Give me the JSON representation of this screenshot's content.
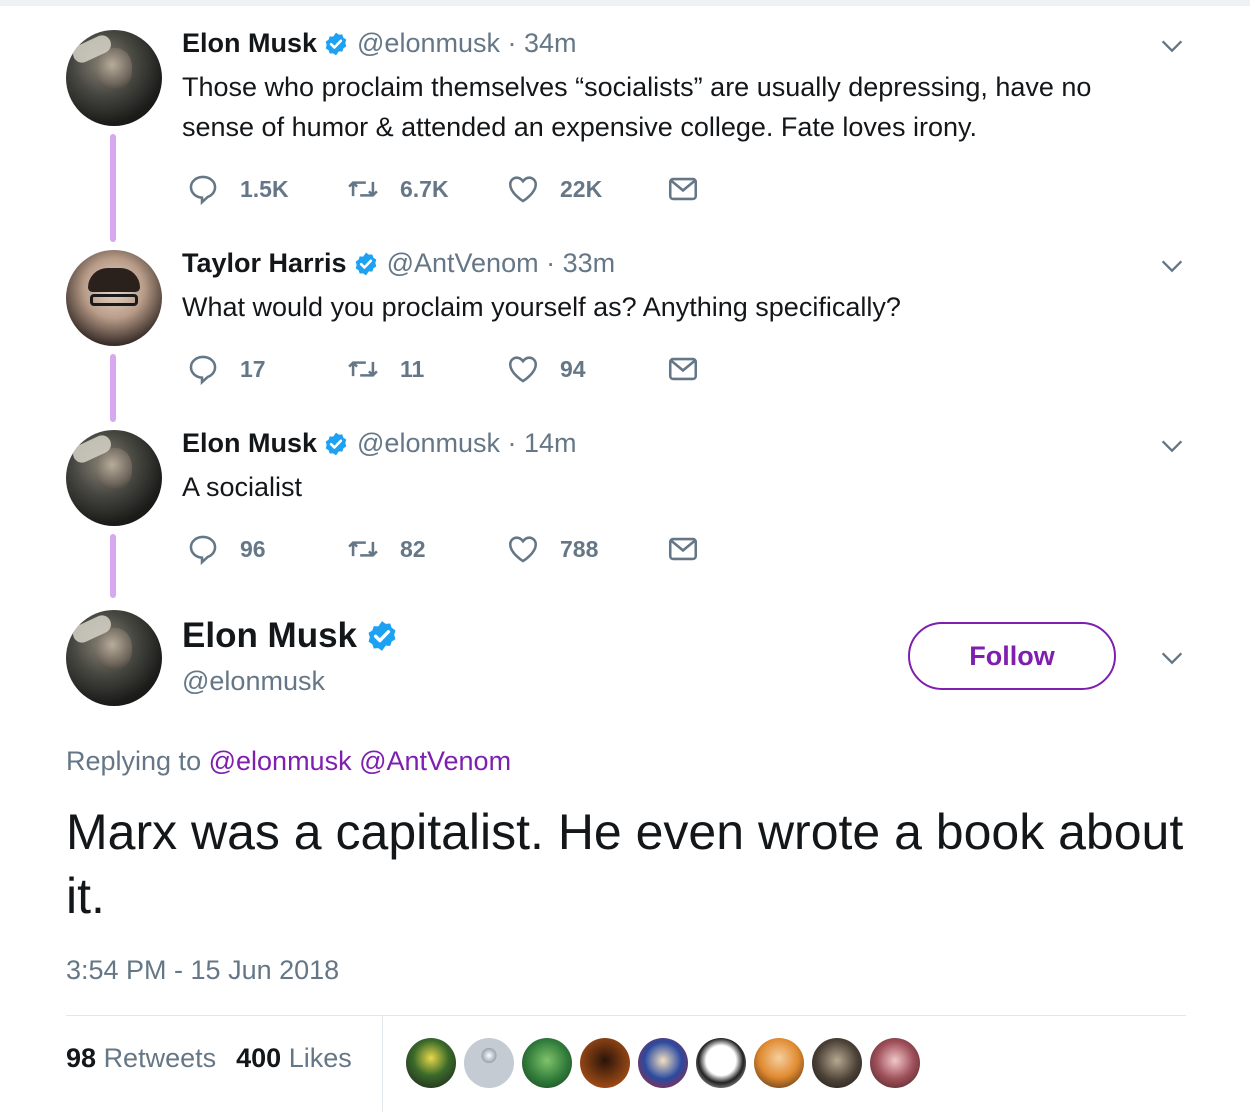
{
  "thread": [
    {
      "name": "Elon Musk",
      "handle": "@elonmusk",
      "time": "· 34m",
      "text": "Those who proclaim themselves “socialists” are usually depressing, have no sense of humor & attended an expensive college. Fate loves irony.",
      "replies": "1.5K",
      "retweets": "6.7K",
      "likes": "22K"
    },
    {
      "name": "Taylor Harris",
      "handle": "@AntVenom",
      "time": "· 33m",
      "text": "What would you proclaim yourself as? Anything specifically?",
      "replies": "17",
      "retweets": "11",
      "likes": "94"
    },
    {
      "name": "Elon Musk",
      "handle": "@elonmusk",
      "time": "· 14m",
      "text": "A socialist",
      "replies": "96",
      "retweets": "82",
      "likes": "788"
    }
  ],
  "main": {
    "name": "Elon Musk",
    "handle": "@elonmusk",
    "follow_label": "Follow",
    "replying_prefix": "Replying to",
    "replying_mentions": "@elonmusk @AntVenom",
    "text": "Marx was a capitalist. He even wrote a book about it.",
    "timestamp": "3:54 PM - 15 Jun 2018",
    "retweets_count": "98",
    "retweets_label": "Retweets",
    "likes_count": "400",
    "likes_label": "Likes"
  },
  "colors": {
    "accent": "#7e1fb0",
    "verified": "#1da1f2",
    "thread_line": "#d7a8f0",
    "muted": "#657786"
  },
  "icons": [
    "reply-icon",
    "retweet-icon",
    "like-icon",
    "direct-message-icon",
    "chevron-down-icon",
    "verified-badge-icon"
  ]
}
